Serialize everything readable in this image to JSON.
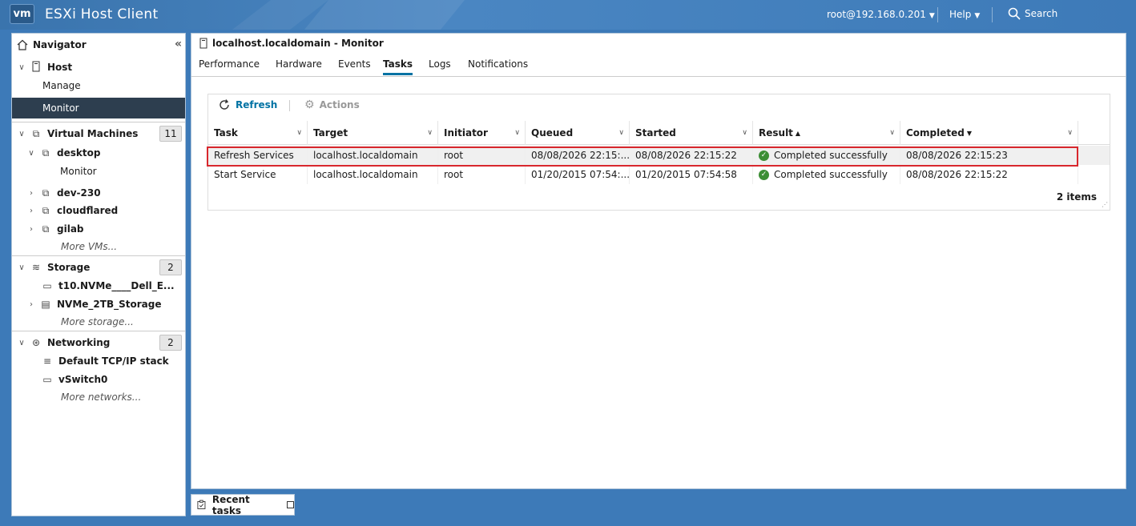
{
  "topbar": {
    "logo": "vm",
    "title": "ESXi Host Client",
    "user": "root@192.168.0.201",
    "help": "Help",
    "search": "Search"
  },
  "navigator": {
    "title": "Navigator",
    "host": {
      "label": "Host",
      "children": [
        "Manage",
        "Monitor"
      ]
    },
    "vms": {
      "label": "Virtual Machines",
      "count": "11",
      "items": [
        "desktop",
        "dev-230",
        "cloudflared",
        "gilab"
      ],
      "desktop_child": "Monitor",
      "more": "More VMs..."
    },
    "storage": {
      "label": "Storage",
      "count": "2",
      "items": [
        "t10.NVMe____Dell_E...",
        "NVMe_2TB_Storage"
      ],
      "more": "More storage..."
    },
    "networking": {
      "label": "Networking",
      "count": "2",
      "items": [
        "Default TCP/IP stack",
        "vSwitch0"
      ],
      "more": "More networks..."
    }
  },
  "main": {
    "title": "localhost.localdomain - Monitor",
    "tabs": [
      "Performance",
      "Hardware",
      "Events",
      "Tasks",
      "Logs",
      "Notifications"
    ],
    "active_tab": "Tasks",
    "toolbar": {
      "refresh": "Refresh",
      "actions": "Actions"
    },
    "columns": [
      "Task",
      "Target",
      "Initiator",
      "Queued",
      "Started",
      "Result",
      "Completed"
    ],
    "rows": [
      [
        "Refresh Services",
        "localhost.localdomain",
        "root",
        "08/08/2026 22:15:...",
        "08/08/2026 22:15:22",
        "Completed successfully",
        "08/08/2026 22:15:23"
      ],
      [
        "Start Service",
        "localhost.localdomain",
        "root",
        "01/20/2015 07:54:...",
        "01/20/2015 07:54:58",
        "Completed successfully",
        "08/08/2026 22:15:22"
      ]
    ],
    "items_count": "2 items"
  },
  "recent_tasks": {
    "label": "Recent tasks"
  }
}
